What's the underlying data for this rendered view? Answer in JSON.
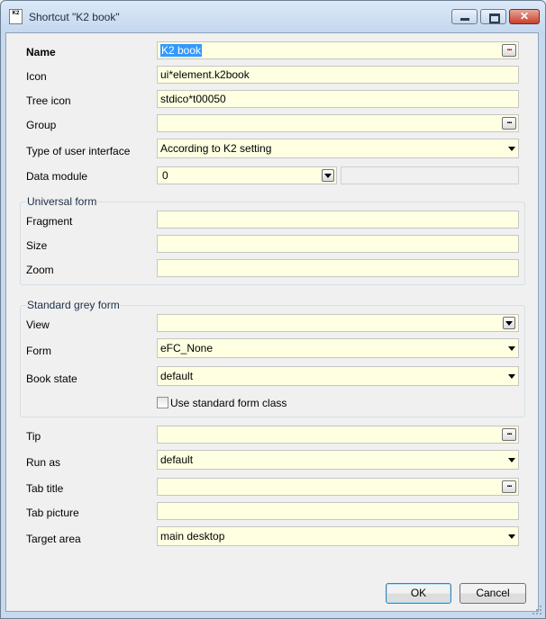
{
  "window": {
    "title": "Shortcut \"K2 book\"",
    "icon_label": "K2",
    "close_glyph": "✕"
  },
  "fields": {
    "name": {
      "label": "Name",
      "value": "K2 book",
      "button": "..."
    },
    "icon": {
      "label": "Icon",
      "value": "ui*element.k2book"
    },
    "tree_icon": {
      "label": "Tree icon",
      "value": "stdico*t00050"
    },
    "group": {
      "label": "Group",
      "value": "",
      "button": "..."
    },
    "ui_type": {
      "label": "Type of user interface",
      "value": "According to K2 setting"
    },
    "data_module": {
      "label": "Data module",
      "value": "0",
      "extra": ""
    }
  },
  "universal_form": {
    "title": "Universal form",
    "fragment": {
      "label": "Fragment",
      "value": ""
    },
    "size": {
      "label": "Size",
      "value": ""
    },
    "zoom": {
      "label": "Zoom",
      "value": ""
    }
  },
  "standard_grey_form": {
    "title": "Standard grey form",
    "view": {
      "label": "View",
      "value": ""
    },
    "form": {
      "label": "Form",
      "value": "eFC_None"
    },
    "book_state": {
      "label": "Book state",
      "value": "default"
    },
    "use_standard_form_class": {
      "label": "Use standard form class",
      "checked": false
    }
  },
  "bottom": {
    "tip": {
      "label": "Tip",
      "value": "",
      "button": "..."
    },
    "run_as": {
      "label": "Run as",
      "value": "default"
    },
    "tab_title": {
      "label": "Tab title",
      "value": "",
      "button": "..."
    },
    "tab_picture": {
      "label": "Tab picture",
      "value": ""
    },
    "target_area": {
      "label": "Target area",
      "value": "main desktop"
    }
  },
  "buttons": {
    "ok": "OK",
    "cancel": "Cancel"
  },
  "colors": {
    "field_bg": "#ffffe1",
    "selection": "#3399ff",
    "window_frame": "#c6d9ee"
  }
}
